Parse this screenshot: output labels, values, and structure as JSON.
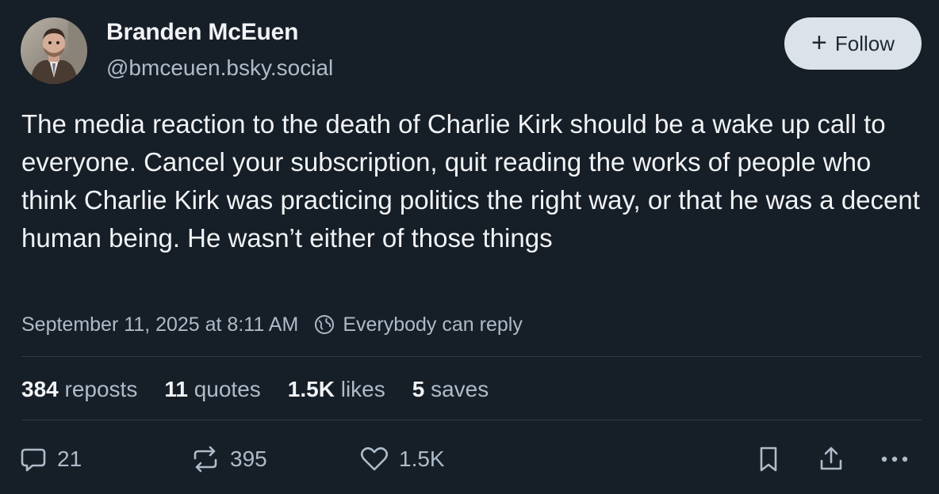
{
  "author": {
    "name": "Branden McEuen",
    "handle": "@bmceuen.bsky.social",
    "avatar_icon": "profile-photo"
  },
  "follow_button": {
    "label": "Follow",
    "icon": "plus-icon"
  },
  "post": {
    "text": "The media reaction to the death of Charlie Kirk should be a wake up call to everyone. Cancel your subscription, quit reading the works of people who think Charlie Kirk was practicing politics the right way, or that he was a decent human being. He wasn’t either of those things",
    "timestamp": "September 11, 2025 at 8:11 AM",
    "reply_setting": "Everybody can reply"
  },
  "stats": {
    "reposts": {
      "count": "384",
      "label": "reposts"
    },
    "quotes": {
      "count": "11",
      "label": "quotes"
    },
    "likes": {
      "count": "1.5K",
      "label": "likes"
    },
    "saves": {
      "count": "5",
      "label": "saves"
    }
  },
  "actions": {
    "reply_count": "21",
    "repost_count": "395",
    "like_count": "1.5K"
  },
  "colors": {
    "background": "#161e27",
    "text": "#f1f3f5",
    "muted": "#aebbc9",
    "divider": "#2e3a48",
    "follow_bg": "#dce2ea"
  }
}
